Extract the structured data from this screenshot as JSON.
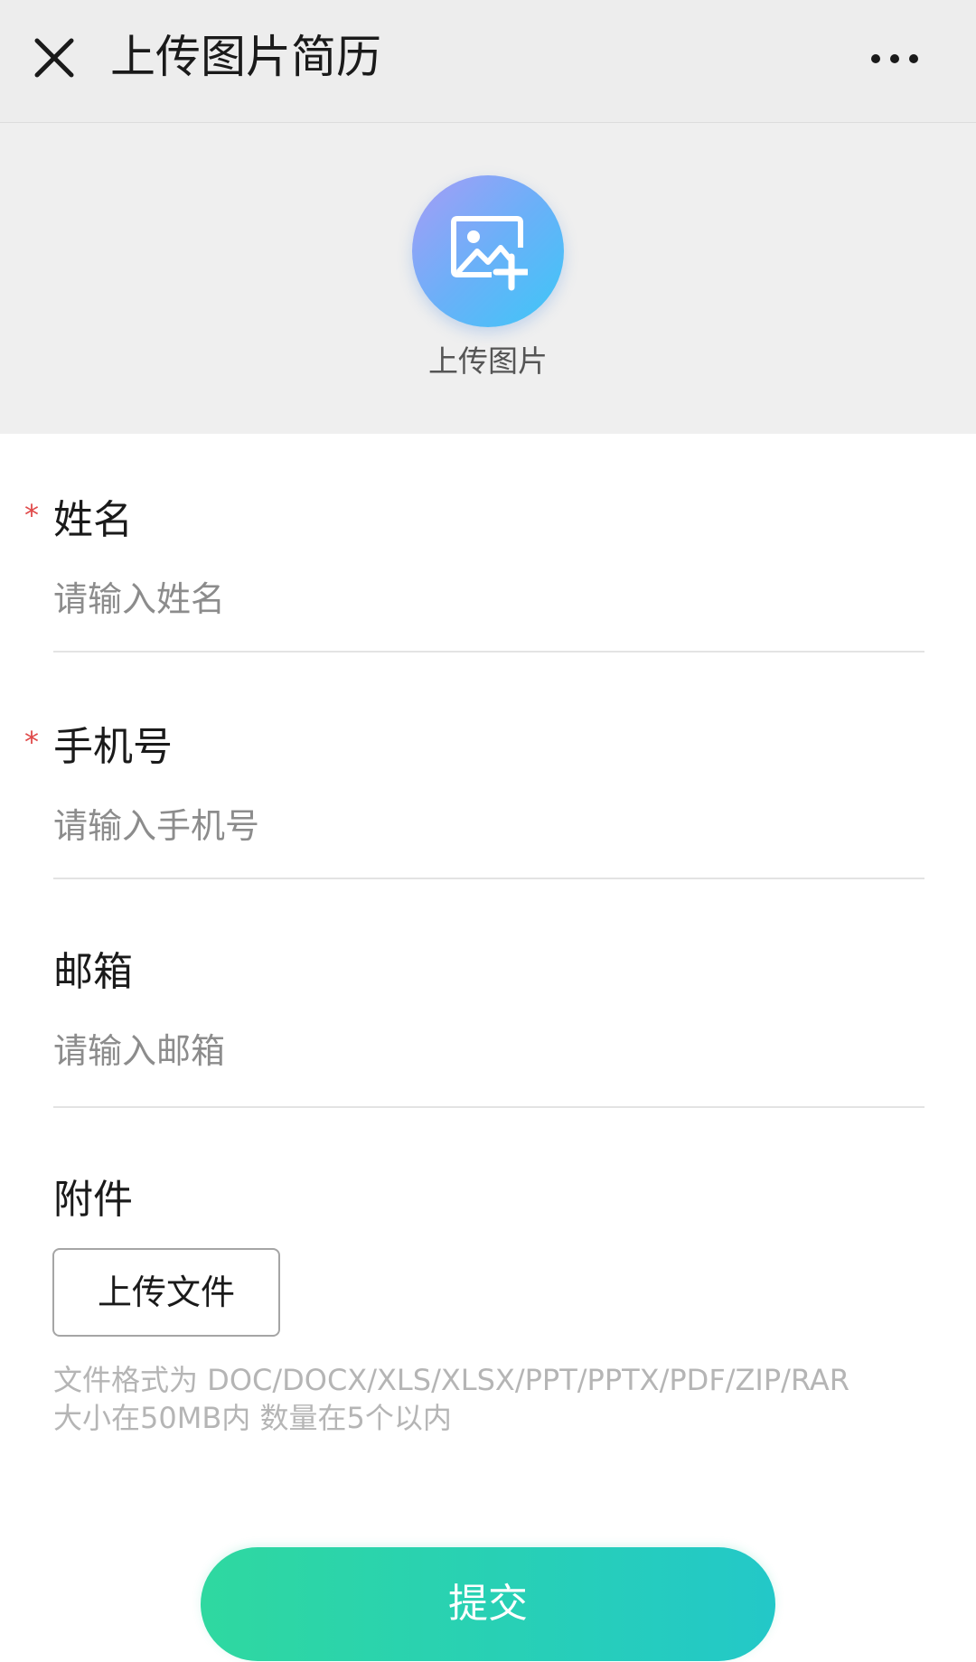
{
  "header": {
    "title": "上传图片简历",
    "close_icon": "close-icon",
    "more_icon": "more-icon"
  },
  "upload_image": {
    "icon": "image-add-icon",
    "label": "上传图片"
  },
  "form": {
    "name": {
      "required_mark": "*",
      "label": "姓名",
      "placeholder": "请输入姓名",
      "value": ""
    },
    "phone": {
      "required_mark": "*",
      "label": "手机号",
      "placeholder": "请输入手机号",
      "value": ""
    },
    "email": {
      "label": "邮箱",
      "placeholder": "请输入邮箱",
      "value": ""
    },
    "attachment": {
      "label": "附件",
      "button_label": "上传文件",
      "hint_line1": "文件格式为 DOC/DOCX/XLS/XLSX/PPT/PPTX/PDF/ZIP/RAR",
      "hint_line2": "大小在50MB内 数量在5个以内"
    }
  },
  "submit_label": "提交",
  "colors": {
    "required": "#e04a4a",
    "submit_start": "#2fd8a0",
    "submit_end": "#23c8c8",
    "upload_circle_start": "#a79cf6",
    "upload_circle_end": "#3cc7f7"
  }
}
